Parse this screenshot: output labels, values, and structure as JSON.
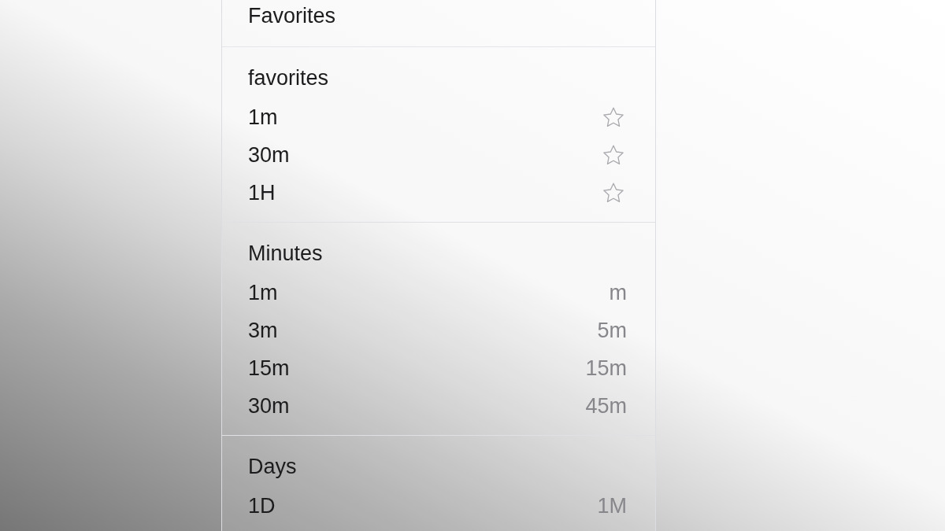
{
  "header": {
    "title": "Favorites"
  },
  "sections": [
    {
      "title": "favorites",
      "rows": [
        {
          "kind": "favorite",
          "label": "1m",
          "starred": false
        },
        {
          "kind": "favorite",
          "label": "30m",
          "starred": false
        },
        {
          "kind": "favorite",
          "label": "1H",
          "starred": false
        }
      ]
    },
    {
      "title": "Minutes",
      "rows": [
        {
          "kind": "pair",
          "label": "1m",
          "right_label": "m"
        },
        {
          "kind": "pair",
          "label": "3m",
          "right_label": "5m"
        },
        {
          "kind": "pair",
          "label": "15m",
          "right_label": "15m"
        },
        {
          "kind": "pair",
          "label": "30m",
          "right_label": "45m"
        }
      ]
    },
    {
      "title": "Days",
      "rows": [
        {
          "kind": "pair",
          "label": "1D",
          "right_label": "1M"
        }
      ]
    }
  ]
}
